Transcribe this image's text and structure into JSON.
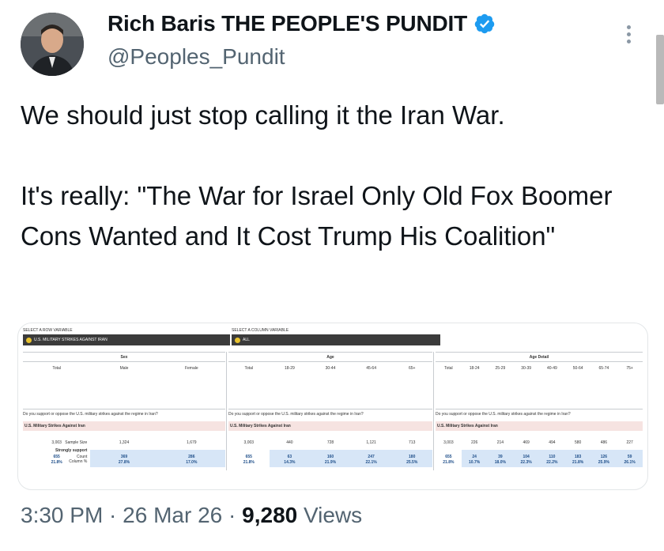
{
  "author": {
    "display_name": "Rich Baris THE PEOPLE'S PUNDIT",
    "handle": "@Peoples_Pundit"
  },
  "tweet": {
    "text": "We should just stop calling it the Iran War.\n\nIt's really: \"The War for Israel Only Old Fox Boomer Cons Wanted and It Cost Trump His Coalition\""
  },
  "meta": {
    "time": "3:30 PM",
    "separator": " · ",
    "date": "26 Mar 26",
    "views_count": "9,280",
    "views_label": " Views"
  },
  "crosstab": {
    "row_selector_label": "SELECT A ROW VARIABLE",
    "row_selector_value": "U.S. MILITARY STRIKES AGAINST IRAN",
    "col_selector_label": "SELECT A COLUMN VARIABLE",
    "col_selector_value": "ALL",
    "question": "Do you support or oppose the U.S. military strikes against the regime in Iran?",
    "subheader": "U.S. Military Strikes Against Iran",
    "row_sample": "Sample Size",
    "row_strong": "Strongly support",
    "row_count": "Count",
    "row_colpct": "Column %",
    "groups": [
      {
        "title": "Sex",
        "cols": [
          "Total",
          "Male",
          "Female"
        ],
        "sample": [
          "3,003",
          "1,324",
          "1,679"
        ],
        "count": [
          "655",
          "369",
          "286"
        ],
        "pct": [
          "21.8%",
          "27.8%",
          "17.0%"
        ]
      },
      {
        "title": "Age",
        "cols": [
          "Total",
          "18-29",
          "30-44",
          "45-64",
          "65+"
        ],
        "sample": [
          "3,003",
          "440",
          "728",
          "1,121",
          "713"
        ],
        "count": [
          "655",
          "63",
          "160",
          "247",
          "180"
        ],
        "pct": [
          "21.8%",
          "14.3%",
          "21.9%",
          "22.1%",
          "25.5%"
        ]
      },
      {
        "title": "Age Detail",
        "cols": [
          "Total",
          "18-24",
          "25-29",
          "30-39",
          "40-49",
          "50-64",
          "65-74",
          "75+"
        ],
        "sample": [
          "3,003",
          "226",
          "214",
          "469",
          "494",
          "580",
          "486",
          "227"
        ],
        "count": [
          "655",
          "24",
          "39",
          "104",
          "110",
          "183",
          "126",
          "59"
        ],
        "pct": [
          "21.8%",
          "10.7%",
          "18.0%",
          "22.3%",
          "22.2%",
          "21.8%",
          "25.9%",
          "26.1%"
        ]
      }
    ]
  },
  "colors": {
    "text": "#0f1419",
    "secondary": "#536471",
    "verified": "#1d9bf0"
  },
  "icons": {
    "verified": "verified-badge-icon",
    "more": "more-vertical-icon"
  }
}
